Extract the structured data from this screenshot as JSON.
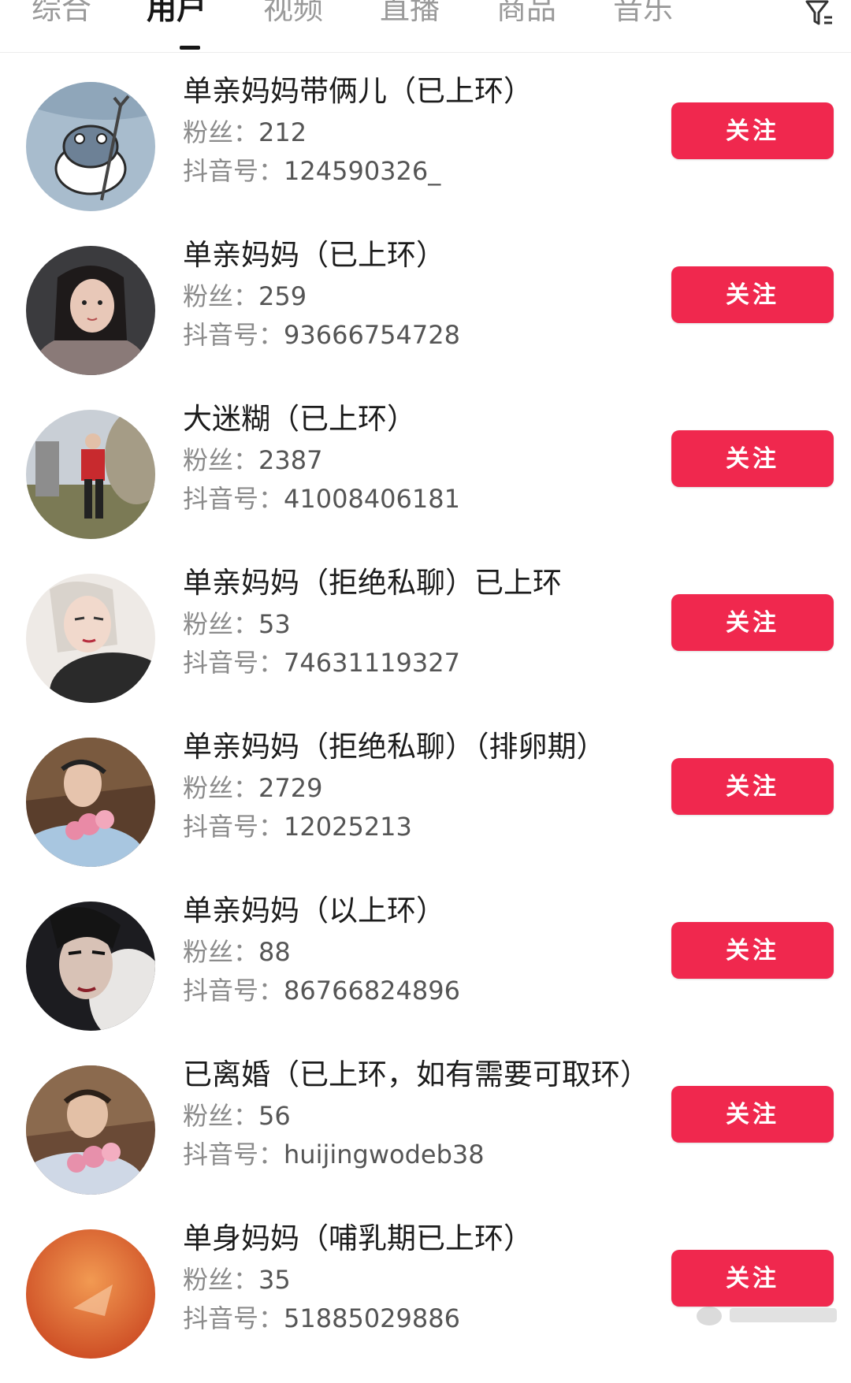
{
  "tabs": [
    {
      "label": "综合",
      "active": false
    },
    {
      "label": "用户",
      "active": true
    },
    {
      "label": "视频",
      "active": false
    },
    {
      "label": "直播",
      "active": false
    },
    {
      "label": "商品",
      "active": false
    },
    {
      "label": "音乐",
      "active": false
    }
  ],
  "labels": {
    "fans_prefix": "粉丝：",
    "id_prefix": "抖音号：",
    "follow": "关注"
  },
  "colors": {
    "accent": "#f0284e"
  },
  "users": [
    {
      "name": "单亲妈妈带俩儿（已上环）",
      "fans": "212",
      "id": "124590326_"
    },
    {
      "name": "单亲妈妈（已上环）",
      "fans": "259",
      "id": "93666754728"
    },
    {
      "name": "大迷糊（已上环）",
      "fans": "2387",
      "id": "41008406181"
    },
    {
      "name": "单亲妈妈（拒绝私聊）已上环",
      "fans": "53",
      "id": "74631119327"
    },
    {
      "name": "单亲妈妈（拒绝私聊）（排卵期）",
      "fans": "2729",
      "id": "12025213"
    },
    {
      "name": "单亲妈妈（以上环）",
      "fans": "88",
      "id": "86766824896"
    },
    {
      "name": "已离婚（已上环，如有需要可取环）",
      "fans": "56",
      "id": "huijingwodeb38"
    },
    {
      "name": "单身妈妈（哺乳期已上环）",
      "fans": "35",
      "id": "51885029886"
    }
  ]
}
